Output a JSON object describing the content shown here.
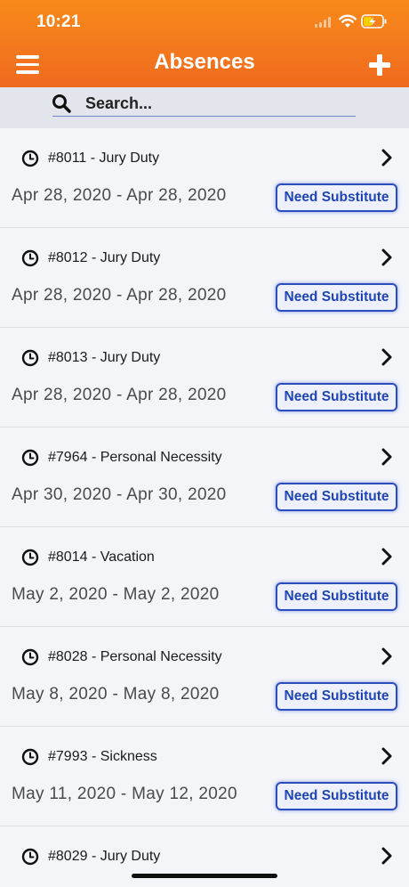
{
  "status_bar": {
    "time": "10:21"
  },
  "header": {
    "title": "Absences",
    "menu_icon": "hamburger-menu-icon",
    "add_icon": "plus-icon"
  },
  "search": {
    "placeholder": "Search..."
  },
  "colors": {
    "header": "#f47a1c",
    "badge": "#2a4fbd"
  },
  "absences": [
    {
      "title": "#8011 - Jury Duty",
      "dates": "Apr 28, 2020 - Apr 28, 2020",
      "status": "Need Substitute"
    },
    {
      "title": "#8012 - Jury Duty",
      "dates": "Apr 28, 2020 - Apr 28, 2020",
      "status": "Need Substitute"
    },
    {
      "title": "#8013 - Jury Duty",
      "dates": "Apr 28, 2020 - Apr 28, 2020",
      "status": "Need Substitute"
    },
    {
      "title": "#7964 - Personal Necessity",
      "dates": "Apr 30, 2020 - Apr 30, 2020",
      "status": "Need Substitute"
    },
    {
      "title": "#8014 - Vacation",
      "dates": "May 2, 2020 - May 2, 2020",
      "status": "Need Substitute"
    },
    {
      "title": "#8028 - Personal Necessity",
      "dates": "May 8, 2020 - May 8, 2020",
      "status": "Need Substitute"
    },
    {
      "title": "#7993 - Sickness",
      "dates": "May 11, 2020 - May 12, 2020",
      "status": "Need Substitute"
    },
    {
      "title": "#8029 - Jury Duty",
      "dates": "",
      "status": ""
    }
  ]
}
